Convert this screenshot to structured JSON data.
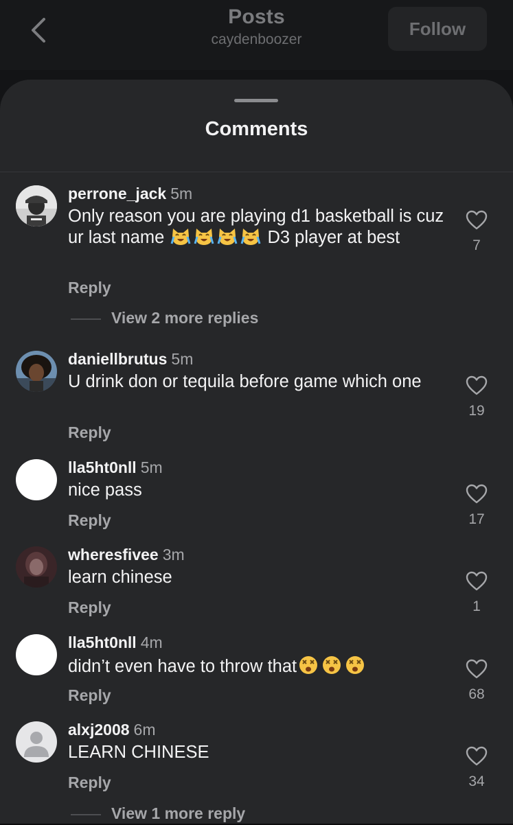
{
  "header": {
    "title": "Posts",
    "subtitle": "caydenboozer",
    "follow_label": "Follow"
  },
  "sheet": {
    "title": "Comments"
  },
  "comments": [
    {
      "username": "perrone_jack",
      "time": "5m",
      "text_part1": "Only reason you are playing d1 basketball is cuz ur last name",
      "text_part2": "D3 player at best",
      "emoji": "crying-cat-emoji",
      "reply": "Reply",
      "likes": "7",
      "more_replies": "View 2 more replies"
    },
    {
      "username": "daniellbrutus",
      "time": "5m",
      "text": "U drink don or tequila before game which one",
      "reply": "Reply",
      "likes": "19"
    },
    {
      "username": "lla5ht0nll",
      "time": "5m",
      "text": "nice pass",
      "reply": "Reply",
      "likes": "17"
    },
    {
      "username": "wheresfivee",
      "time": "3m",
      "text": "learn chinese",
      "reply": "Reply",
      "likes": "1"
    },
    {
      "username": "lla5ht0nll",
      "time": "4m",
      "text": "didn’t even have to throw that",
      "emoji": "dizzy-face-emoji",
      "reply": "Reply",
      "likes": "68"
    },
    {
      "username": "alxj2008",
      "time": "6m",
      "text": "LEARN CHINESE",
      "reply": "Reply",
      "likes": "34",
      "more_replies": "View 1 more reply"
    }
  ],
  "colors": {
    "sheet_bg": "#262729",
    "header_bg": "#17181a",
    "text_primary": "#f3f3f4",
    "text_secondary": "#a6a7aa"
  }
}
